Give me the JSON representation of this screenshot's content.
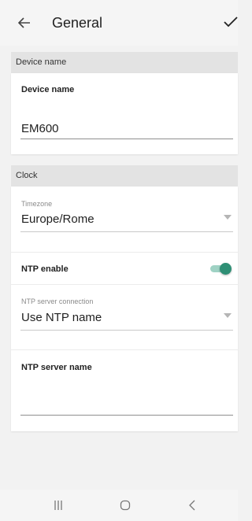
{
  "header": {
    "title": "General",
    "back_icon": "arrow-left-icon",
    "confirm_icon": "check-icon"
  },
  "device_section": {
    "header": "Device name",
    "field_label": "Device name",
    "field_value": "EM600"
  },
  "clock_section": {
    "header": "Clock",
    "timezone_label": "Timezone",
    "timezone_value": "Europe/Rome",
    "ntp_enable_label": "NTP enable",
    "ntp_enabled": true,
    "ntp_connection_label": "NTP server connection",
    "ntp_connection_value": "Use NTP name",
    "ntp_server_label": "NTP server name",
    "ntp_server_value": ""
  },
  "colors": {
    "toggle_accent": "#2f8f75",
    "toggle_track": "#9fd2c4",
    "section_header_bg": "#e3e3e3"
  },
  "navbar": {
    "recents_icon": "recents-icon",
    "home_icon": "home-icon",
    "back_icon": "nav-back-icon"
  }
}
